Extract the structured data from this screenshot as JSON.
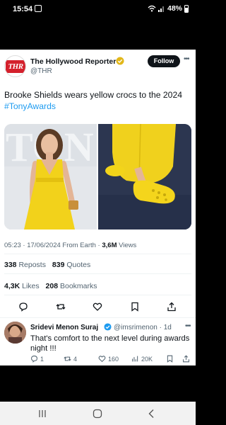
{
  "status_bar": {
    "time": "15:54",
    "battery": "48%",
    "icons": [
      "message-icon",
      "wifi-icon",
      "signal-icon",
      "battery-icon"
    ]
  },
  "tweet": {
    "author_name": "The Hollywood Reporter",
    "author_handle": "@THR",
    "avatar_text": "THR",
    "follow_label": "Follow",
    "text": "Brooke Shields wears yellow crocs to the 2024",
    "hashtag": "#TonyAwards",
    "timestamp": "05:23 · 17/06/2024 From Earth · ",
    "views_count": "3,6M",
    "views_label": " Views",
    "reposts_count": "338",
    "reposts_label": "Reposts",
    "quotes_count": "839",
    "quotes_label": "Quotes",
    "likes_count": "4,3K",
    "likes_label": "Likes",
    "bookmarks_count": "208",
    "bookmarks_label": "Bookmarks",
    "media_backdrop_text": "TON",
    "accent_color": "#1d9bf0",
    "verified_color": "#e2b719"
  },
  "reply": {
    "author_name": "Sridevi Menon Suraj",
    "author_handle": "@imsrimenon · 1d",
    "text": "That's comfort to the next level during awards night !!!",
    "reply_count": "1",
    "repost_count": "4",
    "like_count": "160",
    "view_count": "20K",
    "verified_color": "#1d9bf0"
  },
  "nav_bar": {
    "buttons": [
      "recent-apps-icon",
      "home-icon",
      "back-icon"
    ]
  }
}
